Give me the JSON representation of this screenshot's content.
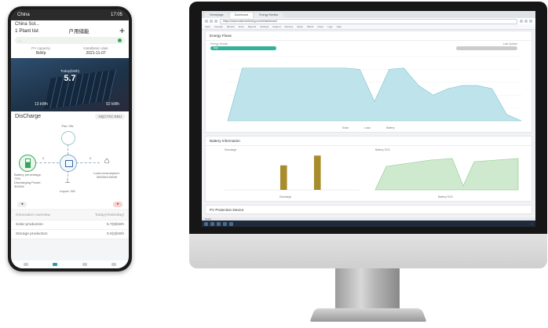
{
  "phone": {
    "status": {
      "carrier": "China",
      "time": "17:05"
    },
    "header": {
      "location": "China Sol... ",
      "plant_title": "1 Plant list",
      "system_name": "户用储能"
    },
    "notice": "…",
    "info": [
      {
        "label": "PV capacity",
        "value": "5kWp"
      },
      {
        "label": "Installation date",
        "value": "2021-11-07"
      }
    ],
    "solar": {
      "caption": "Today(kWh)",
      "power": "5.7",
      "left": "13 kWh",
      "right": "92 kWh"
    },
    "discharge": {
      "title": "DisCharge",
      "device": "NQC7XC-EBU"
    },
    "flow": {
      "pv_label": "Pav: 0W",
      "battery_label": "Battery percentage: 73%\nDischarging Power: 3000W",
      "load_label": "Load consumption:\n3000W/1000W",
      "grid_label": "Import: 0W",
      "left_val": "0",
      "right_val": "0"
    },
    "table": {
      "headers": [
        "Generation overview",
        "Today(Yesterday)"
      ],
      "rows": [
        [
          "Solar production",
          "5.7(8)kWh"
        ],
        [
          "Storage production",
          "0.0(2)kWh"
        ]
      ]
    }
  },
  "browser": {
    "tabs": [
      "Homepage",
      "Dashboard",
      "Energy Monitor"
    ],
    "url": "https://www.solarmonitoring.com/#/dashboard",
    "bookmarks": [
      "Apps",
      "Console",
      "Monitor",
      "Docs",
      "Reports",
      "Settings",
      "Support",
      "Devices",
      "Alerts",
      "Plants",
      "Users",
      "Logs",
      "Help"
    ],
    "energy": {
      "title": "Energy Flows",
      "control_left": "Energy Details",
      "pill_label": "Day",
      "control_right": "Last Update",
      "legend": [
        "Solar",
        "Load",
        "Battery"
      ]
    },
    "battery": {
      "title": "Battery Information",
      "left_label": "Discharge",
      "right_label": "Battery SOC",
      "left_legend": "Discharge",
      "right_legend": "Battery SOC"
    },
    "protection": {
      "title": "PV Protection Device"
    },
    "statusbar": "Ready"
  },
  "colors": {
    "accent": "#32b29b",
    "area_blue": "#bfe3ea",
    "area_green": "#cfe9cf",
    "bar_gold": "#a88c2c"
  },
  "chart_data": [
    {
      "type": "area",
      "series": [
        {
          "name": "Solar",
          "values": [
            0,
            82,
            82,
            82,
            82,
            82,
            82,
            82,
            82,
            80,
            30,
            80,
            82,
            55,
            40,
            50,
            55,
            55,
            50,
            10,
            0
          ]
        }
      ]
    },
    {
      "type": "bar",
      "categories": [
        "1",
        "2",
        "3",
        "4",
        "5",
        "6",
        "7",
        "8"
      ],
      "series": [
        {
          "name": "Discharge",
          "values": [
            0,
            0,
            0,
            2.5,
            0,
            3.5,
            0,
            0
          ]
        }
      ]
    },
    {
      "type": "area",
      "series": [
        {
          "name": "Battery SOC",
          "values": [
            0,
            60,
            64,
            68,
            72,
            76,
            78,
            80,
            10,
            72,
            74,
            76,
            78,
            80
          ]
        }
      ]
    }
  ]
}
